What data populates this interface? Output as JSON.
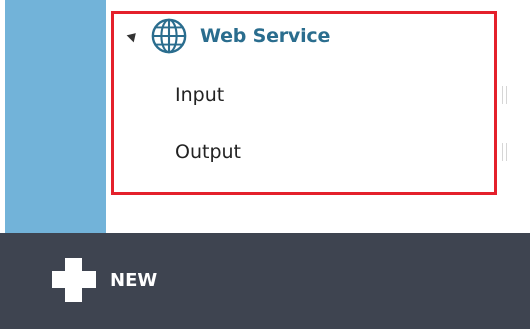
{
  "tree": {
    "title": "Web Service",
    "icon": "globe-icon",
    "expanded": true,
    "items": [
      {
        "label": "Input"
      },
      {
        "label": "Output"
      }
    ]
  },
  "toolbar": {
    "new_label": "NEW",
    "new_icon": "plus-icon"
  },
  "colors": {
    "left_rail": "#72b3d9",
    "bottom_bar": "#3e4450",
    "highlight": "#e4202b",
    "title": "#2a6d8e"
  }
}
